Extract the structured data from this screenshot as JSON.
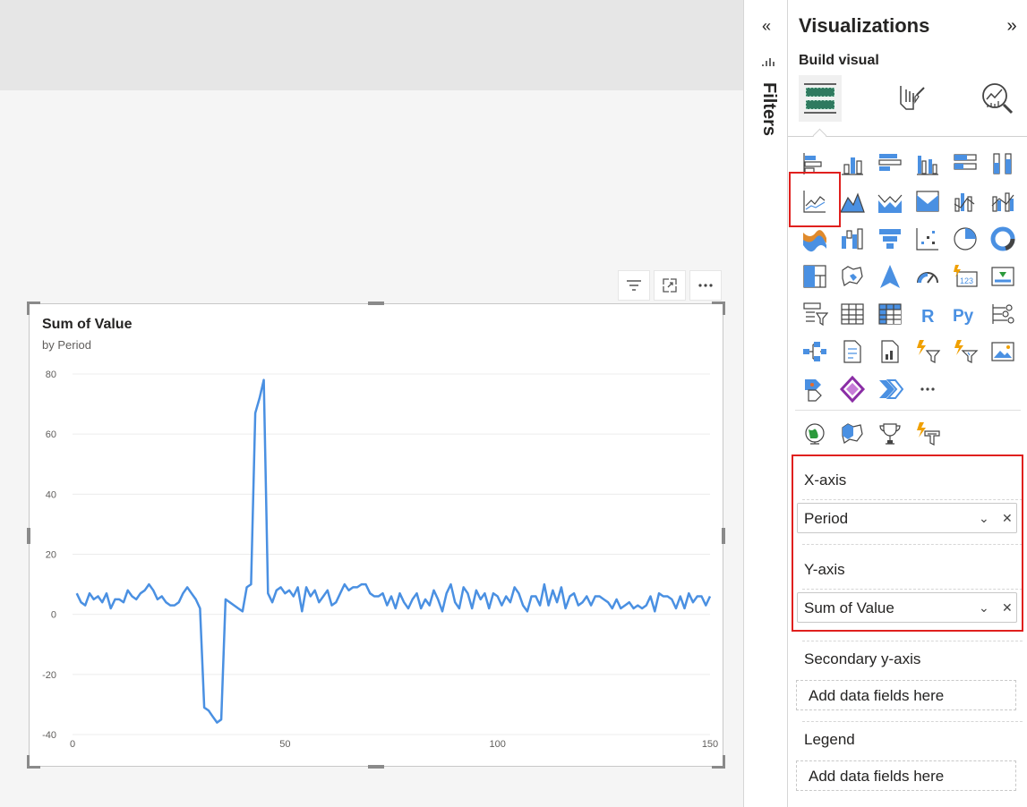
{
  "visual": {
    "title": "Sum of Value",
    "subtitle": "by Period",
    "header_icons": [
      "filter-icon",
      "focus-mode-icon",
      "more-options-icon"
    ]
  },
  "filters_pane": {
    "label": "Filters",
    "collapse_icon": "chevron-double-left-icon"
  },
  "viz_pane": {
    "title": "Visualizations",
    "expand_icon": "chevron-double-right-icon",
    "build_label": "Build visual",
    "tabs": [
      "build-visual-tab",
      "format-visual-tab",
      "analytics-tab"
    ],
    "more_visuals": "···",
    "wells": {
      "xaxis": {
        "label": "X-axis",
        "field": "Period"
      },
      "yaxis": {
        "label": "Y-axis",
        "field": "Sum of Value"
      },
      "secondary": {
        "label": "Secondary y-axis",
        "placeholder": "Add data fields here"
      },
      "legend": {
        "label": "Legend",
        "placeholder": "Add data fields here"
      }
    }
  },
  "colors": {
    "line": "#4a90e2",
    "highlight": "#e0201e",
    "accent": "#118dff"
  },
  "chart_data": {
    "type": "line",
    "title": "Sum of Value",
    "subtitle": "by Period",
    "xlim": [
      0,
      150
    ],
    "ylim": [
      -40,
      80
    ],
    "xticks": [
      "0",
      "50",
      "100",
      "150"
    ],
    "yticks": [
      "80",
      "60",
      "40",
      "20",
      "0",
      "-20",
      "-40"
    ],
    "grid": true,
    "series": [
      {
        "values": [
          [
            1,
            7
          ],
          [
            2,
            4
          ],
          [
            3,
            3
          ],
          [
            4,
            7
          ],
          [
            5,
            5
          ],
          [
            6,
            6
          ],
          [
            7,
            4
          ],
          [
            8,
            7
          ],
          [
            9,
            2
          ],
          [
            10,
            5
          ],
          [
            11,
            5
          ],
          [
            12,
            4
          ],
          [
            13,
            8
          ],
          [
            14,
            6
          ],
          [
            15,
            5
          ],
          [
            16,
            7
          ],
          [
            17,
            8
          ],
          [
            18,
            10
          ],
          [
            19,
            8
          ],
          [
            20,
            5
          ],
          [
            21,
            6
          ],
          [
            22,
            4
          ],
          [
            23,
            3
          ],
          [
            24,
            3
          ],
          [
            25,
            4
          ],
          [
            26,
            7
          ],
          [
            27,
            9
          ],
          [
            28,
            7
          ],
          [
            29,
            5
          ],
          [
            30,
            2
          ],
          [
            31,
            -31
          ],
          [
            32,
            -32
          ],
          [
            33,
            -34
          ],
          [
            34,
            -36
          ],
          [
            35,
            -35
          ],
          [
            36,
            5
          ],
          [
            37,
            4
          ],
          [
            38,
            3
          ],
          [
            39,
            2
          ],
          [
            40,
            1
          ],
          [
            41,
            9
          ],
          [
            42,
            10
          ],
          [
            43,
            67
          ],
          [
            44,
            72
          ],
          [
            45,
            78
          ],
          [
            46,
            7
          ],
          [
            47,
            4
          ],
          [
            48,
            8
          ],
          [
            49,
            9
          ],
          [
            50,
            7
          ],
          [
            51,
            8
          ],
          [
            52,
            6
          ],
          [
            53,
            9
          ],
          [
            54,
            1
          ],
          [
            55,
            9
          ],
          [
            56,
            6
          ],
          [
            57,
            8
          ],
          [
            58,
            4
          ],
          [
            59,
            6
          ],
          [
            60,
            8
          ],
          [
            61,
            3
          ],
          [
            62,
            4
          ],
          [
            63,
            7
          ],
          [
            64,
            10
          ],
          [
            65,
            8
          ],
          [
            66,
            9
          ],
          [
            67,
            9
          ],
          [
            68,
            10
          ],
          [
            69,
            10
          ],
          [
            70,
            7
          ],
          [
            71,
            6
          ],
          [
            72,
            6
          ],
          [
            73,
            7
          ],
          [
            74,
            3
          ],
          [
            75,
            6
          ],
          [
            76,
            2
          ],
          [
            77,
            7
          ],
          [
            78,
            4
          ],
          [
            79,
            2
          ],
          [
            80,
            5
          ],
          [
            81,
            7
          ],
          [
            82,
            2
          ],
          [
            83,
            5
          ],
          [
            84,
            3
          ],
          [
            85,
            8
          ],
          [
            86,
            5
          ],
          [
            87,
            1
          ],
          [
            88,
            7
          ],
          [
            89,
            10
          ],
          [
            90,
            4
          ],
          [
            91,
            2
          ],
          [
            92,
            9
          ],
          [
            93,
            7
          ],
          [
            94,
            2
          ],
          [
            95,
            8
          ],
          [
            96,
            5
          ],
          [
            97,
            7
          ],
          [
            98,
            2
          ],
          [
            99,
            7
          ],
          [
            100,
            6
          ],
          [
            101,
            3
          ],
          [
            102,
            6
          ],
          [
            103,
            4
          ],
          [
            104,
            9
          ],
          [
            105,
            7
          ],
          [
            106,
            3
          ],
          [
            107,
            1
          ],
          [
            108,
            6
          ],
          [
            109,
            6
          ],
          [
            110,
            3
          ],
          [
            111,
            10
          ],
          [
            112,
            3
          ],
          [
            113,
            8
          ],
          [
            114,
            4
          ],
          [
            115,
            9
          ],
          [
            116,
            2
          ],
          [
            117,
            6
          ],
          [
            118,
            7
          ],
          [
            119,
            3
          ],
          [
            120,
            4
          ],
          [
            121,
            6
          ],
          [
            122,
            3
          ],
          [
            123,
            6
          ],
          [
            124,
            6
          ],
          [
            125,
            5
          ],
          [
            126,
            4
          ],
          [
            127,
            2
          ],
          [
            128,
            5
          ],
          [
            129,
            2
          ],
          [
            130,
            3
          ],
          [
            131,
            4
          ],
          [
            132,
            2
          ],
          [
            133,
            3
          ],
          [
            134,
            2
          ],
          [
            135,
            3
          ],
          [
            136,
            6
          ],
          [
            137,
            1
          ],
          [
            138,
            7
          ],
          [
            139,
            6
          ],
          [
            140,
            6
          ],
          [
            141,
            5
          ],
          [
            142,
            2
          ],
          [
            143,
            6
          ],
          [
            144,
            2
          ],
          [
            145,
            7
          ],
          [
            146,
            4
          ],
          [
            147,
            6
          ],
          [
            148,
            6
          ],
          [
            149,
            3
          ],
          [
            150,
            6
          ]
        ]
      }
    ]
  }
}
